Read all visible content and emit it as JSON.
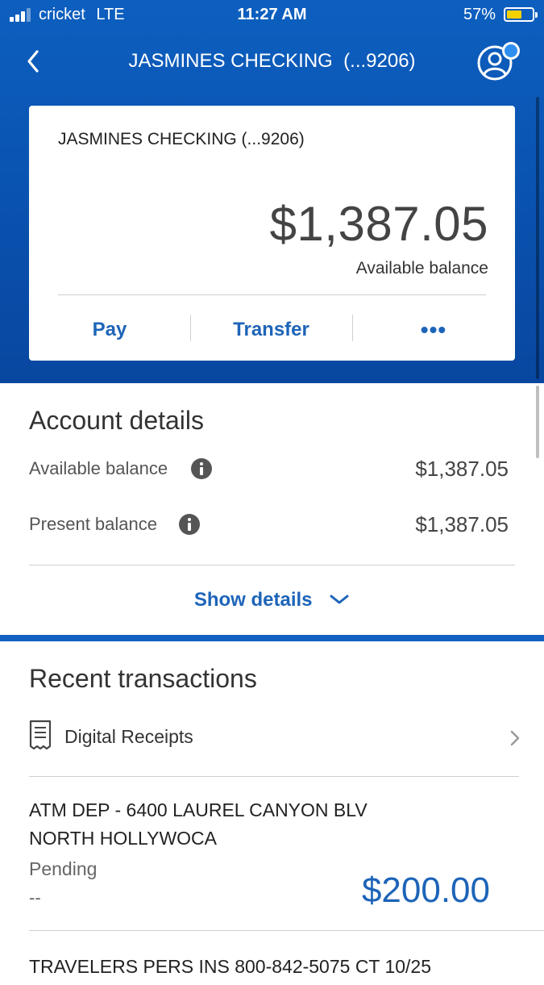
{
  "status_bar": {
    "carrier": "cricket",
    "network": "LTE",
    "time": "11:27 AM",
    "battery_percent": "57%",
    "battery_level": 0.57,
    "battery_color": "#f7d000"
  },
  "nav": {
    "back_icon": "chevron-left-icon",
    "title": "JASMINES CHECKING  (...9206)",
    "profile_icon": "profile-settings-icon"
  },
  "account_card": {
    "name": "JASMINES CHECKING (...9206)",
    "balance": "$1,387.05",
    "balance_label": "Available balance",
    "actions": {
      "pay": "Pay",
      "transfer": "Transfer",
      "more": "•••"
    }
  },
  "account_details": {
    "title": "Account details",
    "rows": [
      {
        "label": "Available balance",
        "value": "$1,387.05",
        "icon": "info-icon"
      },
      {
        "label": "Present balance",
        "value": "$1,387.05",
        "icon": "info-icon"
      }
    ],
    "show_details": "Show details"
  },
  "recent_transactions": {
    "title": "Recent transactions",
    "digital_receipts": "Digital Receipts",
    "items": [
      {
        "description_line1": "ATM DEP - 6400 LAUREL CANYON BLV",
        "description_line2": "NORTH HOLLYWOCA",
        "status": "Pending",
        "date": "--",
        "amount": "$200.00"
      },
      {
        "description_line1": "TRAVELERS PERS INS 800-842-5075 CT 10/25"
      }
    ]
  },
  "colors": {
    "brand_blue": "#0a55b3",
    "link_blue": "#1d64b8"
  }
}
